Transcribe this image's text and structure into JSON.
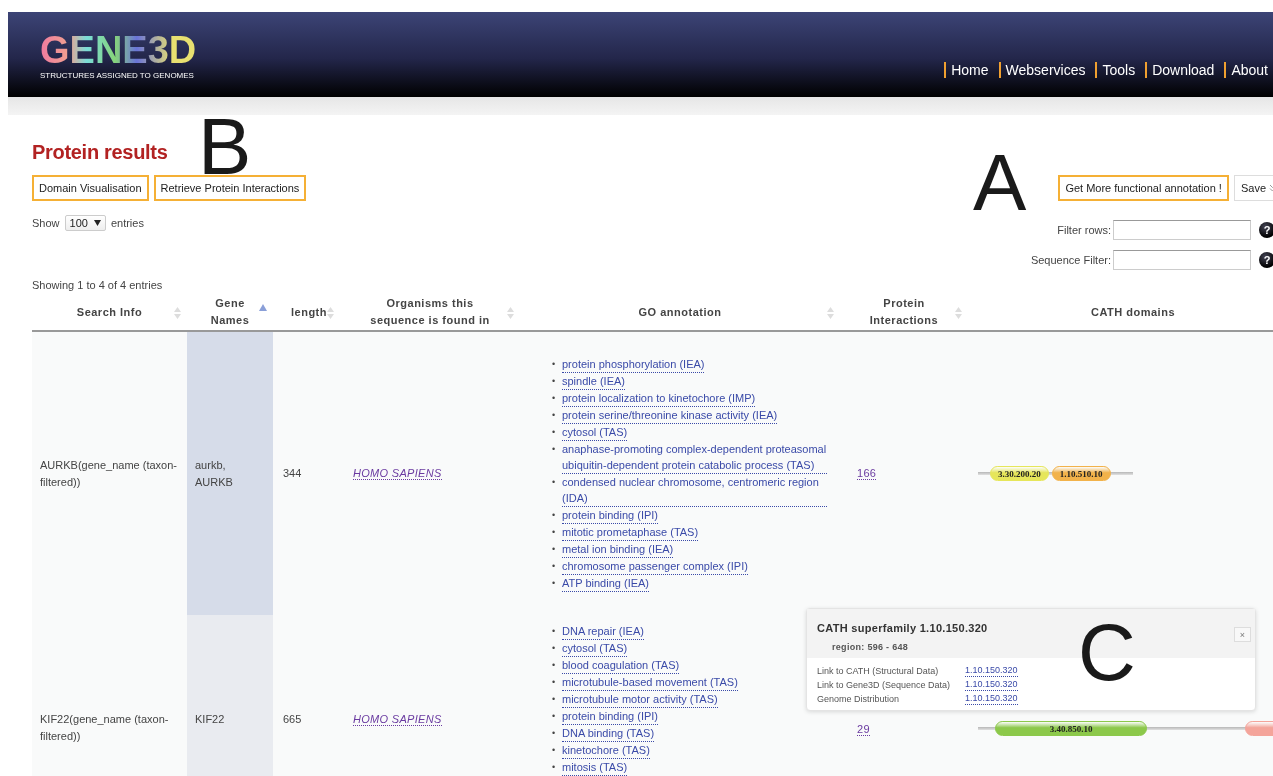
{
  "header": {
    "logo": "GENE3D",
    "tagline": "STRUCTURES ASSIGNED TO GENOMES",
    "nav": [
      "Home",
      "Webservices",
      "Tools",
      "Download",
      "About"
    ]
  },
  "page": {
    "title": "Protein results",
    "left_buttons": [
      "Domain Visualisation",
      "Retrieve Protein Interactions"
    ],
    "annotate_button": "Get More functional annotation !",
    "save_button": "Save",
    "show": {
      "before": "Show",
      "value": "100",
      "after": "entries"
    },
    "filters": [
      {
        "label": "Filter rows:",
        "help": "?"
      },
      {
        "label": "Sequence Filter:",
        "help": "?"
      }
    ],
    "info": "Showing 1 to 4 of 4 entries"
  },
  "table": {
    "columns": [
      {
        "title": "Search Info",
        "sortable": true,
        "sorted": false
      },
      {
        "title": "Gene Names",
        "sortable": true,
        "sorted": true
      },
      {
        "title": "length",
        "sortable": true,
        "sorted": false
      },
      {
        "title": "Organisms this sequence is found in",
        "sortable": true,
        "sorted": false
      },
      {
        "title": "GO annotation",
        "sortable": true,
        "sorted": false
      },
      {
        "title": "Protein Interactions",
        "sortable": true,
        "sorted": false
      },
      {
        "title": "CATH domains"
      }
    ],
    "bullet": "•",
    "rows": [
      {
        "search_info": "AURKB(gene_name (taxon-filtered))",
        "gene_names": "aurkb, AURKB",
        "length": "344",
        "organism": "HOMO SAPIENS",
        "go": [
          "protein phosphorylation (IEA)",
          "spindle (IEA)",
          "protein localization to kinetochore (IMP)",
          "protein serine/threonine kinase activity (IEA)",
          "cytosol (TAS)",
          "anaphase-promoting complex-dependent proteasomal ubiquitin-dependent protein catabolic process (TAS)",
          "condensed nuclear chromosome, centromeric region (IDA)",
          "protein binding (IPI)",
          "mitotic prometaphase (TAS)",
          "metal ion binding (IEA)",
          "chromosome passenger complex (IPI)",
          "ATP binding (IEA)"
        ],
        "interactions": "166",
        "domains": [
          {
            "label": "3.30.200.20",
            "color": "#e6e65a"
          },
          {
            "label": "1.10.510.10",
            "color": "#f2b24a"
          }
        ]
      },
      {
        "search_info": "KIF22(gene_name (taxon-filtered))",
        "gene_names": "KIF22",
        "length": "665",
        "organism": "HOMO SAPIENS",
        "go": [
          "DNA repair (IEA)",
          "cytosol (TAS)",
          "blood coagulation (TAS)",
          "microtubule-based movement (TAS)",
          "microtubule motor activity (TAS)",
          "protein binding (IPI)",
          "DNA binding (TAS)",
          "kinetochore (TAS)",
          "mitosis (TAS)"
        ],
        "interactions": "29",
        "domains": [
          {
            "label": "3.40.850.10",
            "color": "#8cc84a"
          },
          {
            "color": "#f4a49a"
          }
        ]
      }
    ]
  },
  "popup": {
    "title": "CATH superfamily 1.10.150.320",
    "region": "region: 596 - 648",
    "close": "×",
    "links": [
      {
        "label": "Link to CATH (Structural Data)",
        "value": "1.10.150.320"
      },
      {
        "label": "Link to Gene3D (Sequence Data)",
        "value": "1.10.150.320"
      },
      {
        "label": "Genome Distribution",
        "value": "1.10.150.320"
      }
    ]
  },
  "annotation_labels": [
    "A",
    "B",
    "C"
  ]
}
